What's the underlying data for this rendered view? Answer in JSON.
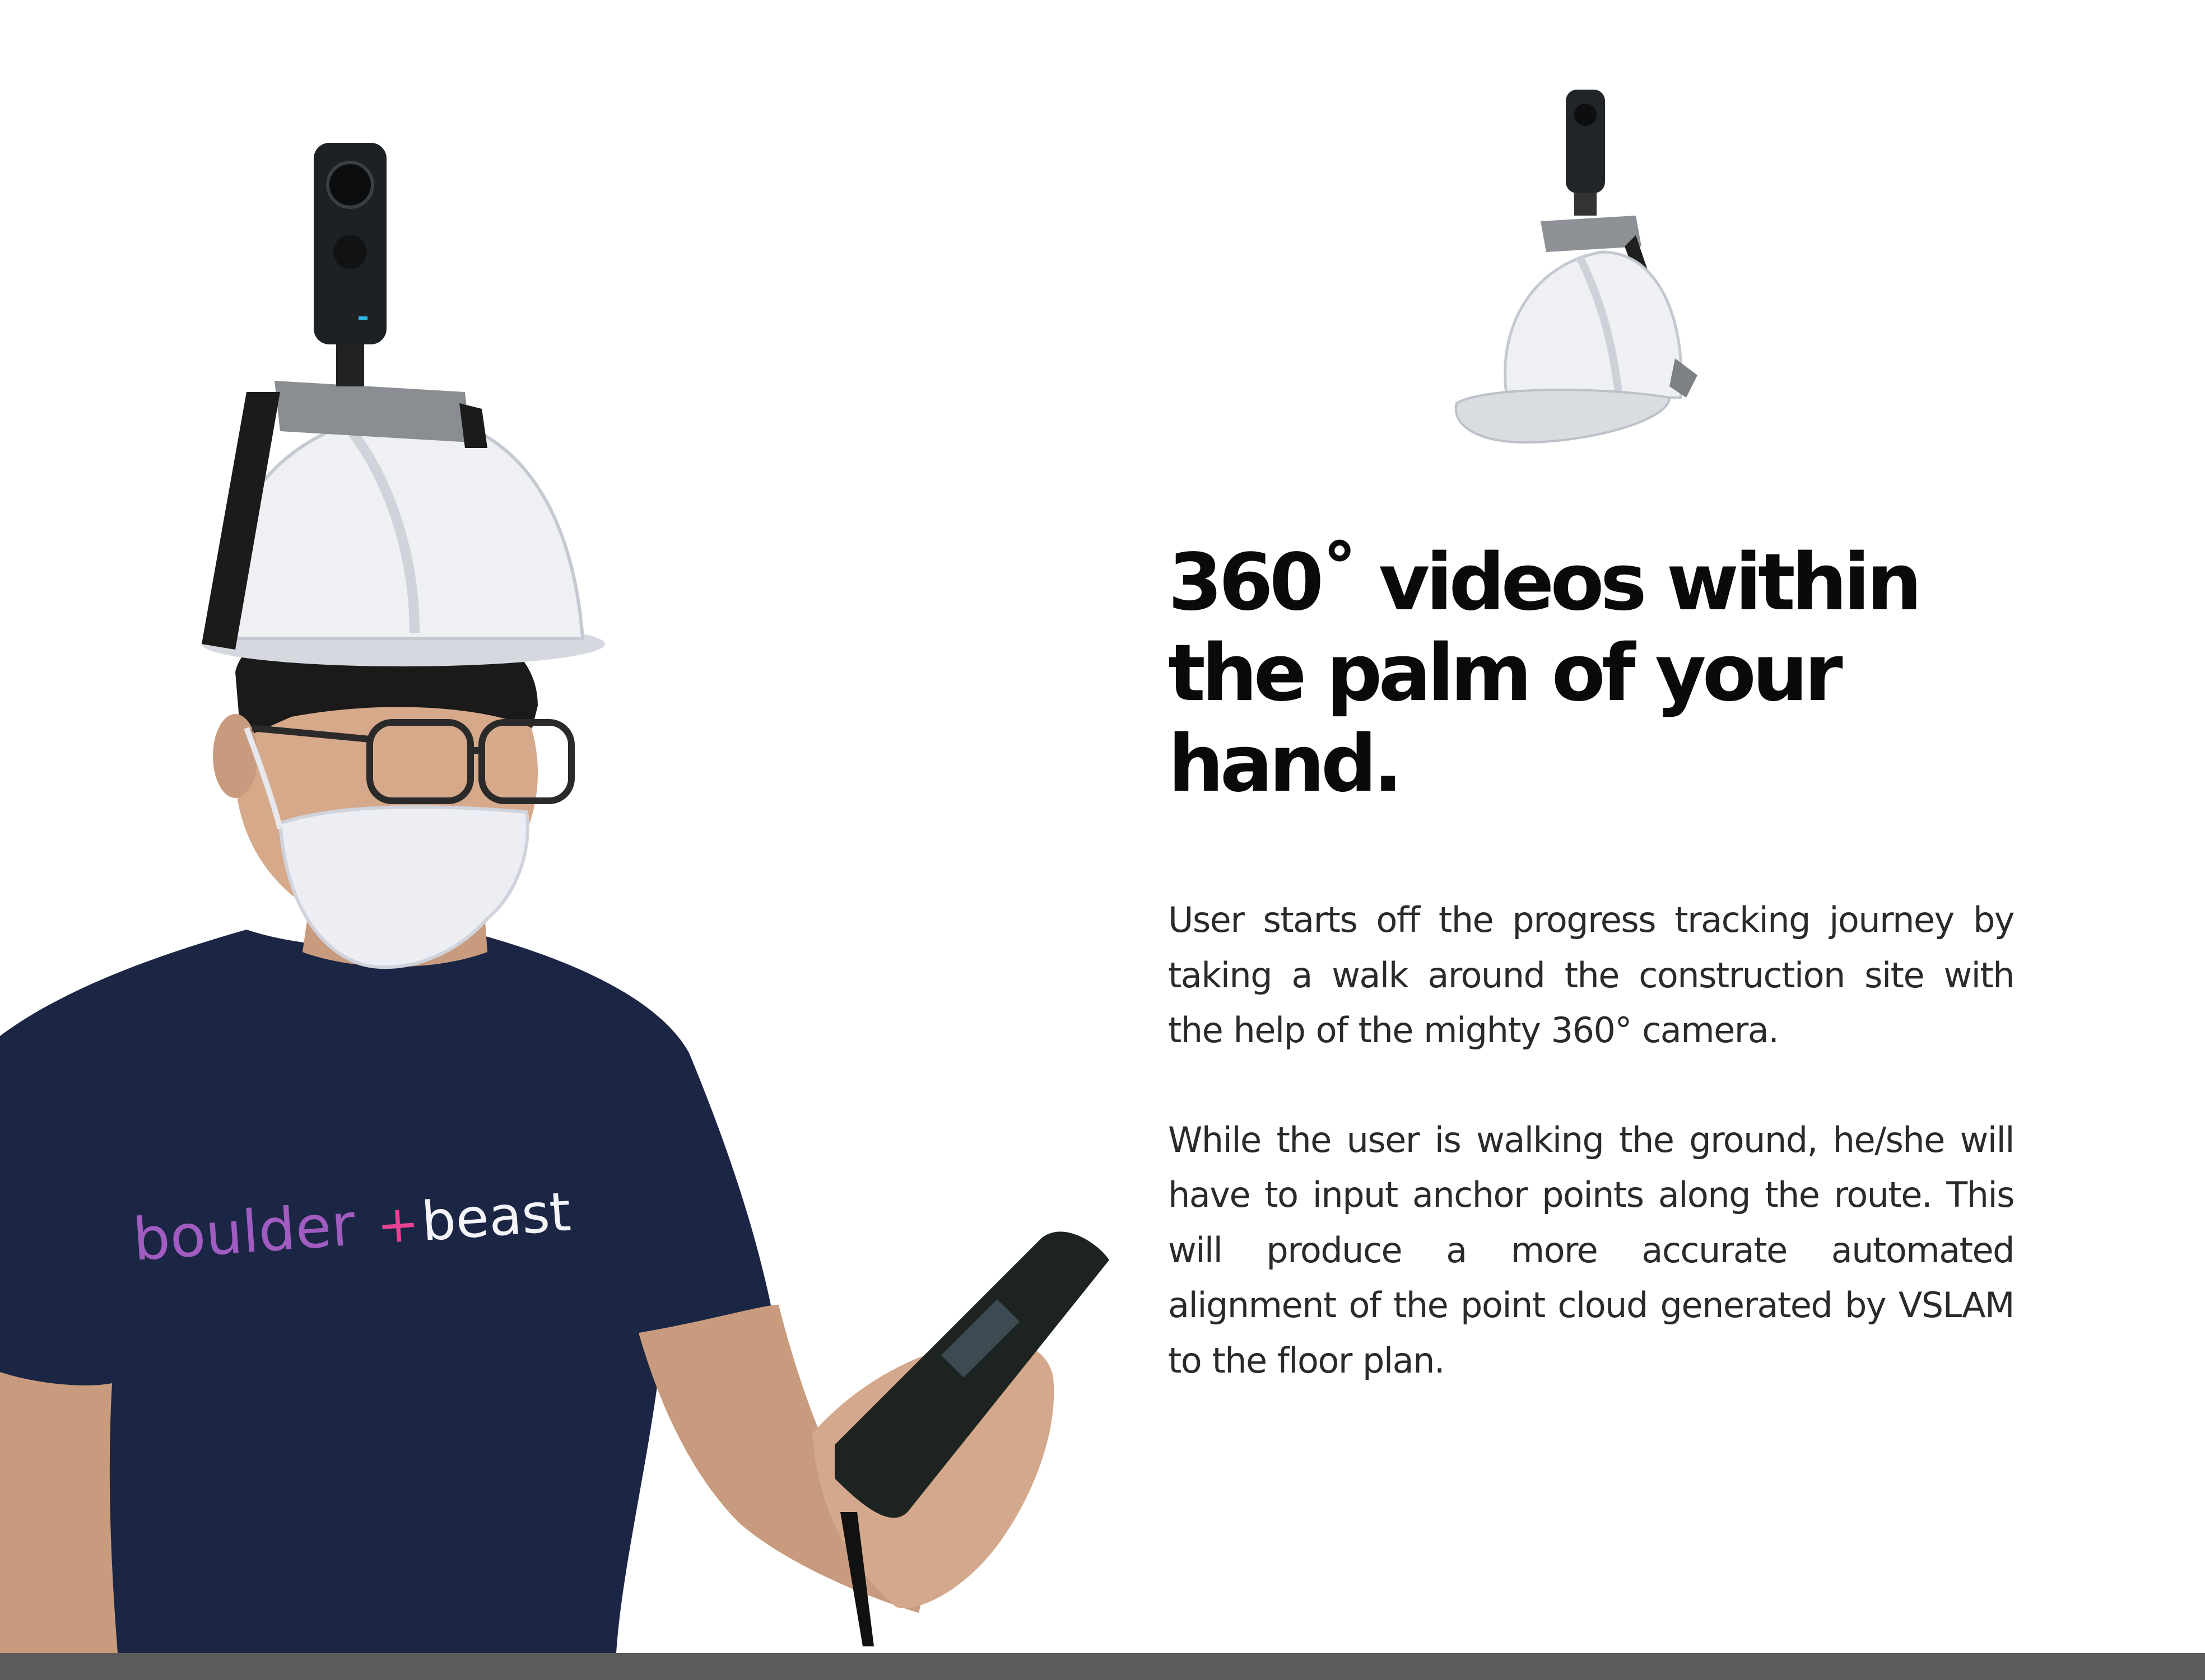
{
  "headline": "360˚ videos within the palm of your hand.",
  "paragraphs": {
    "p1": "User starts off the progress tracking journey by taking a walk around the construction site with the help of the mighty 360° camera.",
    "p2": "While the user is walking the ground, he/she will have to input anchor points along the route. This will produce a more accurate automated alignment of the point cloud generated by VSLAM to the floor plan."
  },
  "shirt_logo": {
    "word1": "boulder",
    "plus": "+",
    "word2": "beast"
  },
  "colors": {
    "shirt_navy": "#1b2644",
    "helmet_white": "#eef0f4",
    "bottom_bar": "#5b5b5b",
    "logo_purple": "#9b59b6",
    "logo_pink": "#e84393"
  }
}
